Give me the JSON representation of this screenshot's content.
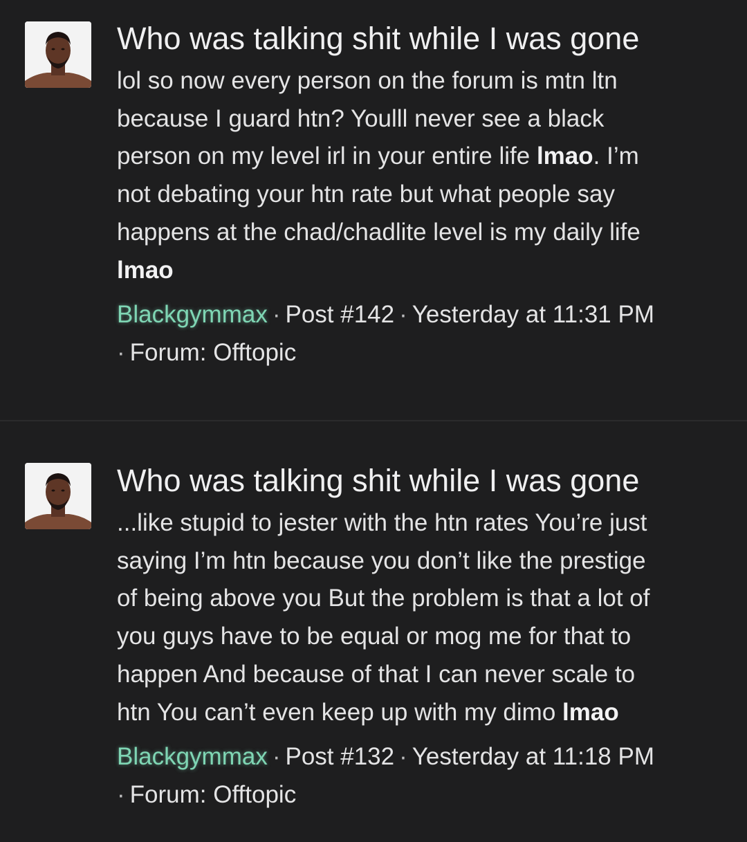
{
  "colors": {
    "background": "#1e1e1f",
    "text": "#e4e4e5",
    "username": "#7fd6b4",
    "divider": "#2b2b2c"
  },
  "results": [
    {
      "avatar_icon": "user-avatar",
      "title": "Who was talking shit while I was gone",
      "snippet_lines": [
        {
          "text": "lol so now every person on the forum is mtn ltn",
          "bold": ""
        },
        {
          "text": "because I guard htn? Youlll never see a black",
          "bold": ""
        },
        {
          "text": "person on my level irl in your entire life ",
          "bold": "lmao",
          "after": ". I’m"
        },
        {
          "text": "not debating your htn rate but what people say",
          "bold": ""
        },
        {
          "text": "happens at the chad/chadlite level is my daily life",
          "bold": ""
        },
        {
          "text": "",
          "bold": "lmao"
        }
      ],
      "username": "Blackgymmax",
      "separator": "·",
      "post": "Post #142",
      "time": "Yesterday at 11:31 PM",
      "forum": "Forum: Offtopic"
    },
    {
      "avatar_icon": "user-avatar",
      "title": "Who was talking shit while I was gone",
      "snippet_lines": [
        {
          "text": "...like stupid to jester with the htn rates You’re just",
          "bold": ""
        },
        {
          "text": "saying I’m htn because you don’t like the prestige",
          "bold": ""
        },
        {
          "text": "of being above you But the problem is that a lot of",
          "bold": ""
        },
        {
          "text": "you guys have to be equal or mog me for that to",
          "bold": ""
        },
        {
          "text": "happen And because of that I can never scale to",
          "bold": ""
        },
        {
          "text": "htn You can’t even keep up with my dimo ",
          "bold": "lmao"
        }
      ],
      "username": "Blackgymmax",
      "separator": "·",
      "post": "Post #132",
      "time": "Yesterday at 11:18 PM",
      "forum": "Forum: Offtopic"
    }
  ]
}
